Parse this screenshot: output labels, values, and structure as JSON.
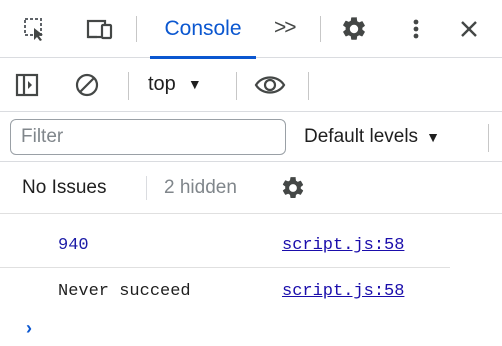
{
  "tabbar": {
    "active_tab": "Console",
    "more_tabs": ">>"
  },
  "toolbar": {
    "context": "top",
    "context_caret": "▼"
  },
  "filter": {
    "placeholder": "Filter",
    "levels_label": "Default levels",
    "levels_caret": "▼"
  },
  "issues": {
    "status": "No Issues",
    "hidden": "2 hidden"
  },
  "messages": [
    {
      "text": "940",
      "source": "script.js:58"
    },
    {
      "text": "Never succeed",
      "source": "script.js:58"
    }
  ],
  "prompt": "›",
  "colors": {
    "accent": "#0b57d0",
    "number": "#1a1aa6",
    "link": "#1a0dab"
  },
  "icons": [
    "inspect-element-icon",
    "device-toolbar-icon",
    "settings-gear-icon",
    "more-vertical-icon",
    "close-icon",
    "sidebar-toggle-icon",
    "clear-console-icon",
    "live-expression-eye-icon",
    "issues-gear-icon"
  ]
}
